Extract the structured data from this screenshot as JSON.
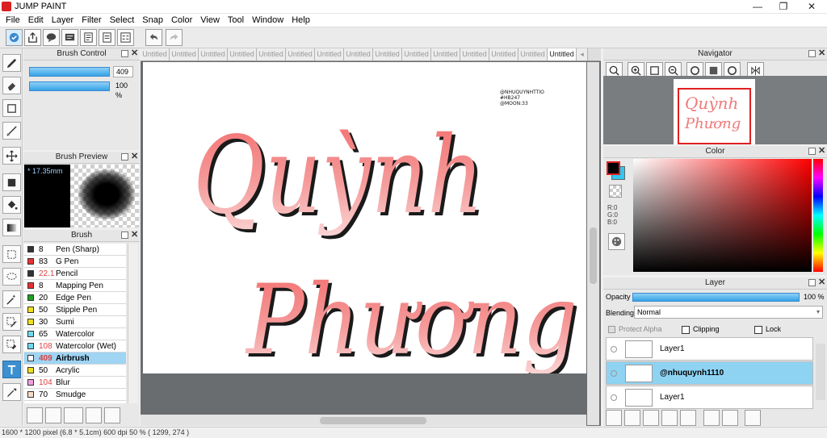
{
  "app": {
    "title": "JUMP PAINT"
  },
  "window_controls": {
    "minimize": "—",
    "maximize": "❐",
    "close": "✕"
  },
  "menu": [
    "File",
    "Edit",
    "Layer",
    "Filter",
    "Select",
    "Snap",
    "Color",
    "View",
    "Tool",
    "Window",
    "Help"
  ],
  "brush_control": {
    "title": "Brush Control",
    "size_value": "409",
    "opacity_value": "100 %"
  },
  "brush_preview": {
    "title": "Brush Preview",
    "size_label": "* 17.35mm"
  },
  "brush": {
    "title": "Brush",
    "items": [
      {
        "size": "8",
        "name": "Pen (Sharp)",
        "color": "#333333"
      },
      {
        "size": "83",
        "name": "G Pen",
        "color": "#e83030"
      },
      {
        "size": "22.1",
        "name": "Pencil",
        "color": "#333333",
        "size_color": "#e04040"
      },
      {
        "size": "8",
        "name": "Mapping Pen",
        "color": "#e83030"
      },
      {
        "size": "20",
        "name": "Edge Pen",
        "color": "#20a020"
      },
      {
        "size": "50",
        "name": "Stipple Pen",
        "color": "#f0e020"
      },
      {
        "size": "30",
        "name": "Sumi",
        "color": "#f0e020"
      },
      {
        "size": "65",
        "name": "Watercolor",
        "color": "#70d8f0"
      },
      {
        "size": "108",
        "name": "Watercolor (Wet)",
        "color": "#70d8f0",
        "size_color": "#e04040"
      },
      {
        "size": "409",
        "name": "Airbrush",
        "color": "#ffffff",
        "size_color": "#e04040",
        "selected": true
      },
      {
        "size": "50",
        "name": "Acrylic",
        "color": "#f0e020"
      },
      {
        "size": "104",
        "name": "Blur",
        "color": "#f0a0e0",
        "size_color": "#e04040"
      },
      {
        "size": "70",
        "name": "Smudge",
        "color": "#f8dcc8"
      }
    ]
  },
  "tabs": [
    "Untitled",
    "Untitled",
    "Untitled",
    "Untitled",
    "Untitled",
    "Untitled",
    "Untitled",
    "Untitled",
    "Untitled",
    "Untitled",
    "Untitled",
    "Untitled",
    "Untitled",
    "Untitled",
    "Untitled"
  ],
  "canvas": {
    "watermark_lines": [
      "@NHUQUYNHTTIO",
      "#HB247",
      "@MOON:33"
    ],
    "line1": "Quỳnh",
    "line2": "Phương",
    "text_color": "#f08080"
  },
  "navigator": {
    "title": "Navigator",
    "thumb_line1": "Quỳnh",
    "thumb_line2": "Phương"
  },
  "color": {
    "title": "Color",
    "primary": "#000000",
    "secondary": "#30c8f0",
    "r": "R:0",
    "g": "G:0",
    "b": "B:0"
  },
  "layer": {
    "title": "Layer",
    "opacity_label": "Opacity",
    "opacity_value": "100 %",
    "blending_label": "Blending",
    "blending_value": "Normal",
    "protect_alpha": "Protect Alpha",
    "clipping": "Clipping",
    "lock": "Lock",
    "layers": [
      {
        "name": "Layer1",
        "selected": false
      },
      {
        "name": "@nhuquynh1110",
        "selected": true
      },
      {
        "name": "Layer1",
        "selected": false
      }
    ]
  },
  "status": {
    "text": "1600 * 1200 pixel  (6.8 * 5.1cm)  600 dpi  50 %  ( 1299, 274 )"
  }
}
